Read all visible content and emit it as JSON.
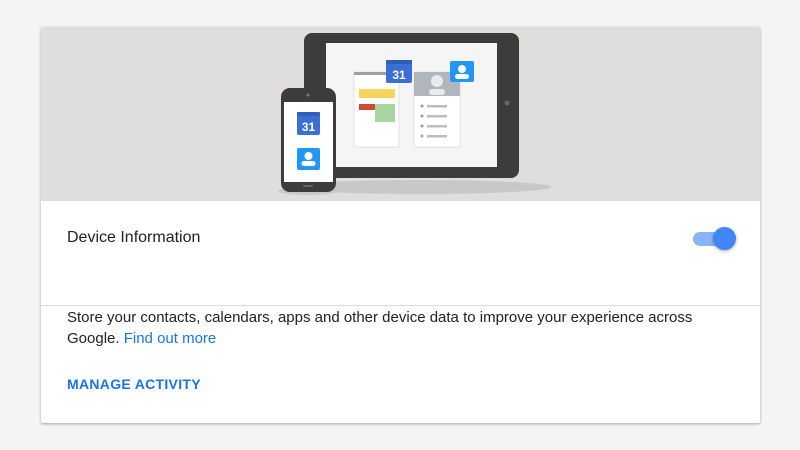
{
  "hero": {
    "calendar_date": "31",
    "colors": {
      "background": "#dfdedc",
      "device_frame": "#3c3c3c",
      "calendar_blue": "#3b6fd4",
      "contact_blue": "#2196f3"
    }
  },
  "setting": {
    "title": "Device Information",
    "toggle_on": true,
    "toggle_color": "#4285f4"
  },
  "description": {
    "text": "Store your contacts, calendars, apps and other device data to improve your experience across Google. ",
    "link": "Find out more"
  },
  "actions": {
    "manage_label": "MANAGE ACTIVITY"
  },
  "colors": {
    "accent": "#1a73e8",
    "page_bg": "#f4f4f4"
  }
}
